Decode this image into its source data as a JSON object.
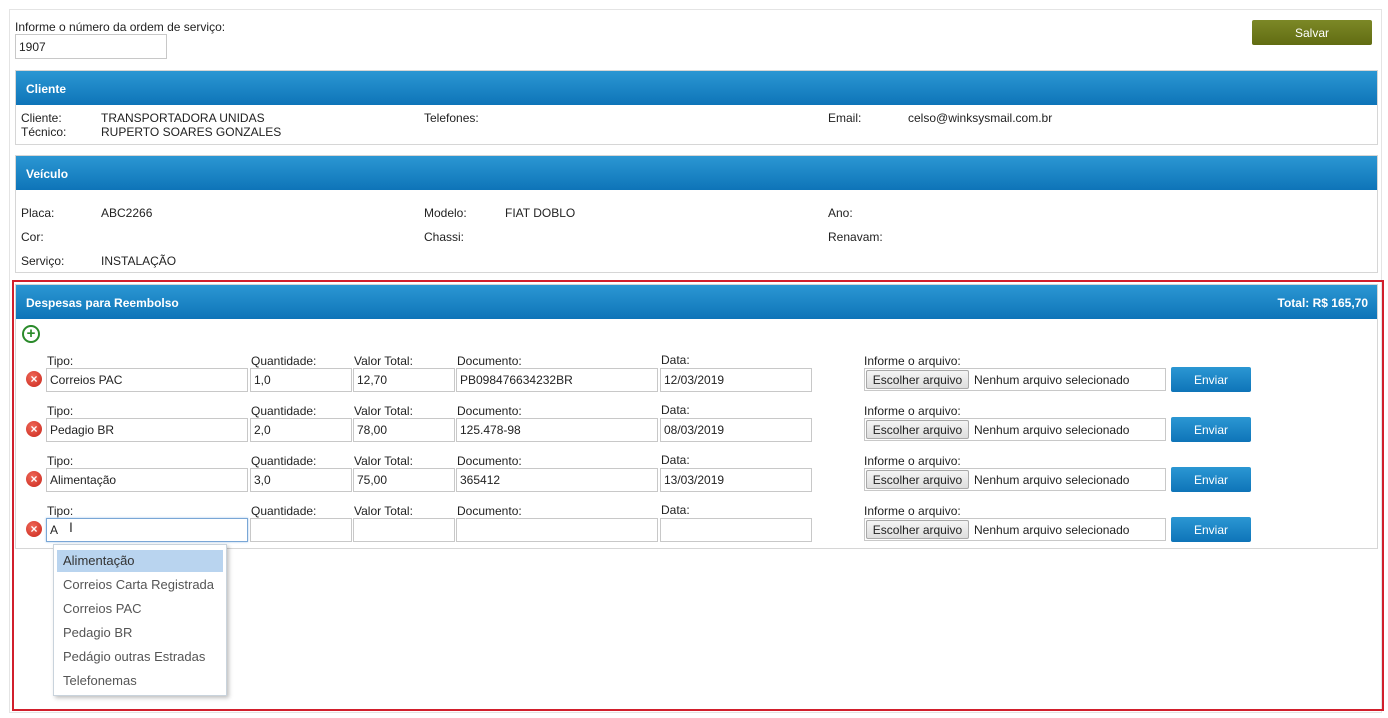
{
  "order": {
    "label": "Informe o número da ordem de serviço:",
    "value": "1907"
  },
  "save_label": "Salvar",
  "cliente": {
    "title": "Cliente",
    "cliente_label": "Cliente:",
    "cliente_value": "TRANSPORTADORA UNIDAS",
    "tecnico_label": "Técnico:",
    "tecnico_value": "RUPERTO SOARES GONZALES",
    "telefones_label": "Telefones:",
    "email_label": "Email:",
    "email_value": "celso@winksysmail.com.br"
  },
  "veiculo": {
    "title": "Veículo",
    "placa_label": "Placa:",
    "placa_value": "ABC2266",
    "modelo_label": "Modelo:",
    "modelo_value": "FIAT DOBLO",
    "ano_label": "Ano:",
    "cor_label": "Cor:",
    "chassi_label": "Chassi:",
    "renavam_label": "Renavam:",
    "servico_label": "Serviço:",
    "servico_value": "INSTALAÇÃO"
  },
  "despesas": {
    "title": "Despesas para Reembolso",
    "total": "Total: R$ 165,70",
    "labels": {
      "tipo": "Tipo:",
      "quantidade": "Quantidade:",
      "valor": "Valor Total:",
      "documento": "Documento:",
      "data": "Data:",
      "arquivo": "Informe o arquivo:"
    },
    "file_button": "Escolher arquivo",
    "file_none": "Nenhum arquivo selecionado",
    "send_label": "Enviar",
    "rows": [
      {
        "tipo": "Correios PAC",
        "quantidade": "1,0",
        "valor": "12,70",
        "documento": "PB098476634232BR",
        "data": "12/03/2019"
      },
      {
        "tipo": "Pedagio BR",
        "quantidade": "2,0",
        "valor": "78,00",
        "documento": "125.478-98",
        "data": "08/03/2019"
      },
      {
        "tipo": "Alimentação",
        "quantidade": "3,0",
        "valor": "75,00",
        "documento": "365412",
        "data": "13/03/2019"
      },
      {
        "tipo": "A",
        "quantidade": "",
        "valor": "",
        "documento": "",
        "data": ""
      }
    ]
  },
  "autocomplete": {
    "options": [
      "Alimentação",
      "Correios Carta Registrada",
      "Correios PAC",
      "Pedagio BR",
      "Pedágio outras Estradas",
      "Telefonemas"
    ],
    "selected_index": 0
  },
  "colors": {
    "header_blue": "#1a86c7",
    "save_olive": "#6f7a1a",
    "highlight_red": "#d11f2c",
    "delete_red": "#d9342b",
    "add_green": "#2a8a2a"
  }
}
